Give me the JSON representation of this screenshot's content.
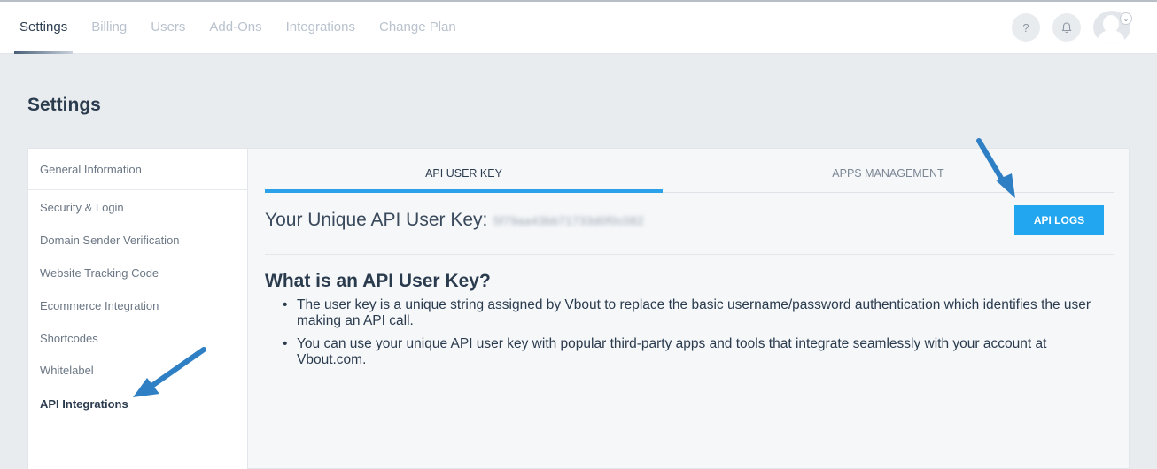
{
  "nav": {
    "items": [
      {
        "label": "Settings",
        "active": true
      },
      {
        "label": "Billing",
        "active": false
      },
      {
        "label": "Users",
        "active": false
      },
      {
        "label": "Add-Ons",
        "active": false
      },
      {
        "label": "Integrations",
        "active": false
      },
      {
        "label": "Change Plan",
        "active": false
      }
    ],
    "help_icon": "?",
    "notifications_icon": "bell-icon",
    "caret_icon": "⌄"
  },
  "page": {
    "title": "Settings"
  },
  "sidebar": {
    "items": [
      {
        "label": "General Information"
      },
      {
        "label": "Security & Login"
      },
      {
        "label": "Domain Sender Verification"
      },
      {
        "label": "Website Tracking Code"
      },
      {
        "label": "Ecommerce Integration"
      },
      {
        "label": "Shortcodes"
      },
      {
        "label": "Whitelabel"
      },
      {
        "label": "API Integrations",
        "active": true
      }
    ]
  },
  "tabs": [
    {
      "label": "API USER KEY",
      "active": true
    },
    {
      "label": "APPS MANAGEMENT",
      "active": false
    }
  ],
  "api_key": {
    "label": "Your Unique API User Key:",
    "value": "5f79aa43bb71733d0f0c082",
    "logs_button": "API LOGS"
  },
  "info": {
    "title": "What is an API User Key?",
    "bullets": [
      "The user key is a unique string assigned by Vbout to replace the basic username/password authentication which identifies the user making an API call.",
      "You can use your unique API user key with popular third-party apps and tools that integrate seamlessly with your account at Vbout.com."
    ]
  },
  "colors": {
    "accent": "#23a6f0",
    "tab_underline": "#2aa1e8",
    "arrow": "#2f7fc4",
    "text_dark": "#2b3b4e",
    "nav_muted": "#b9c2cd"
  }
}
